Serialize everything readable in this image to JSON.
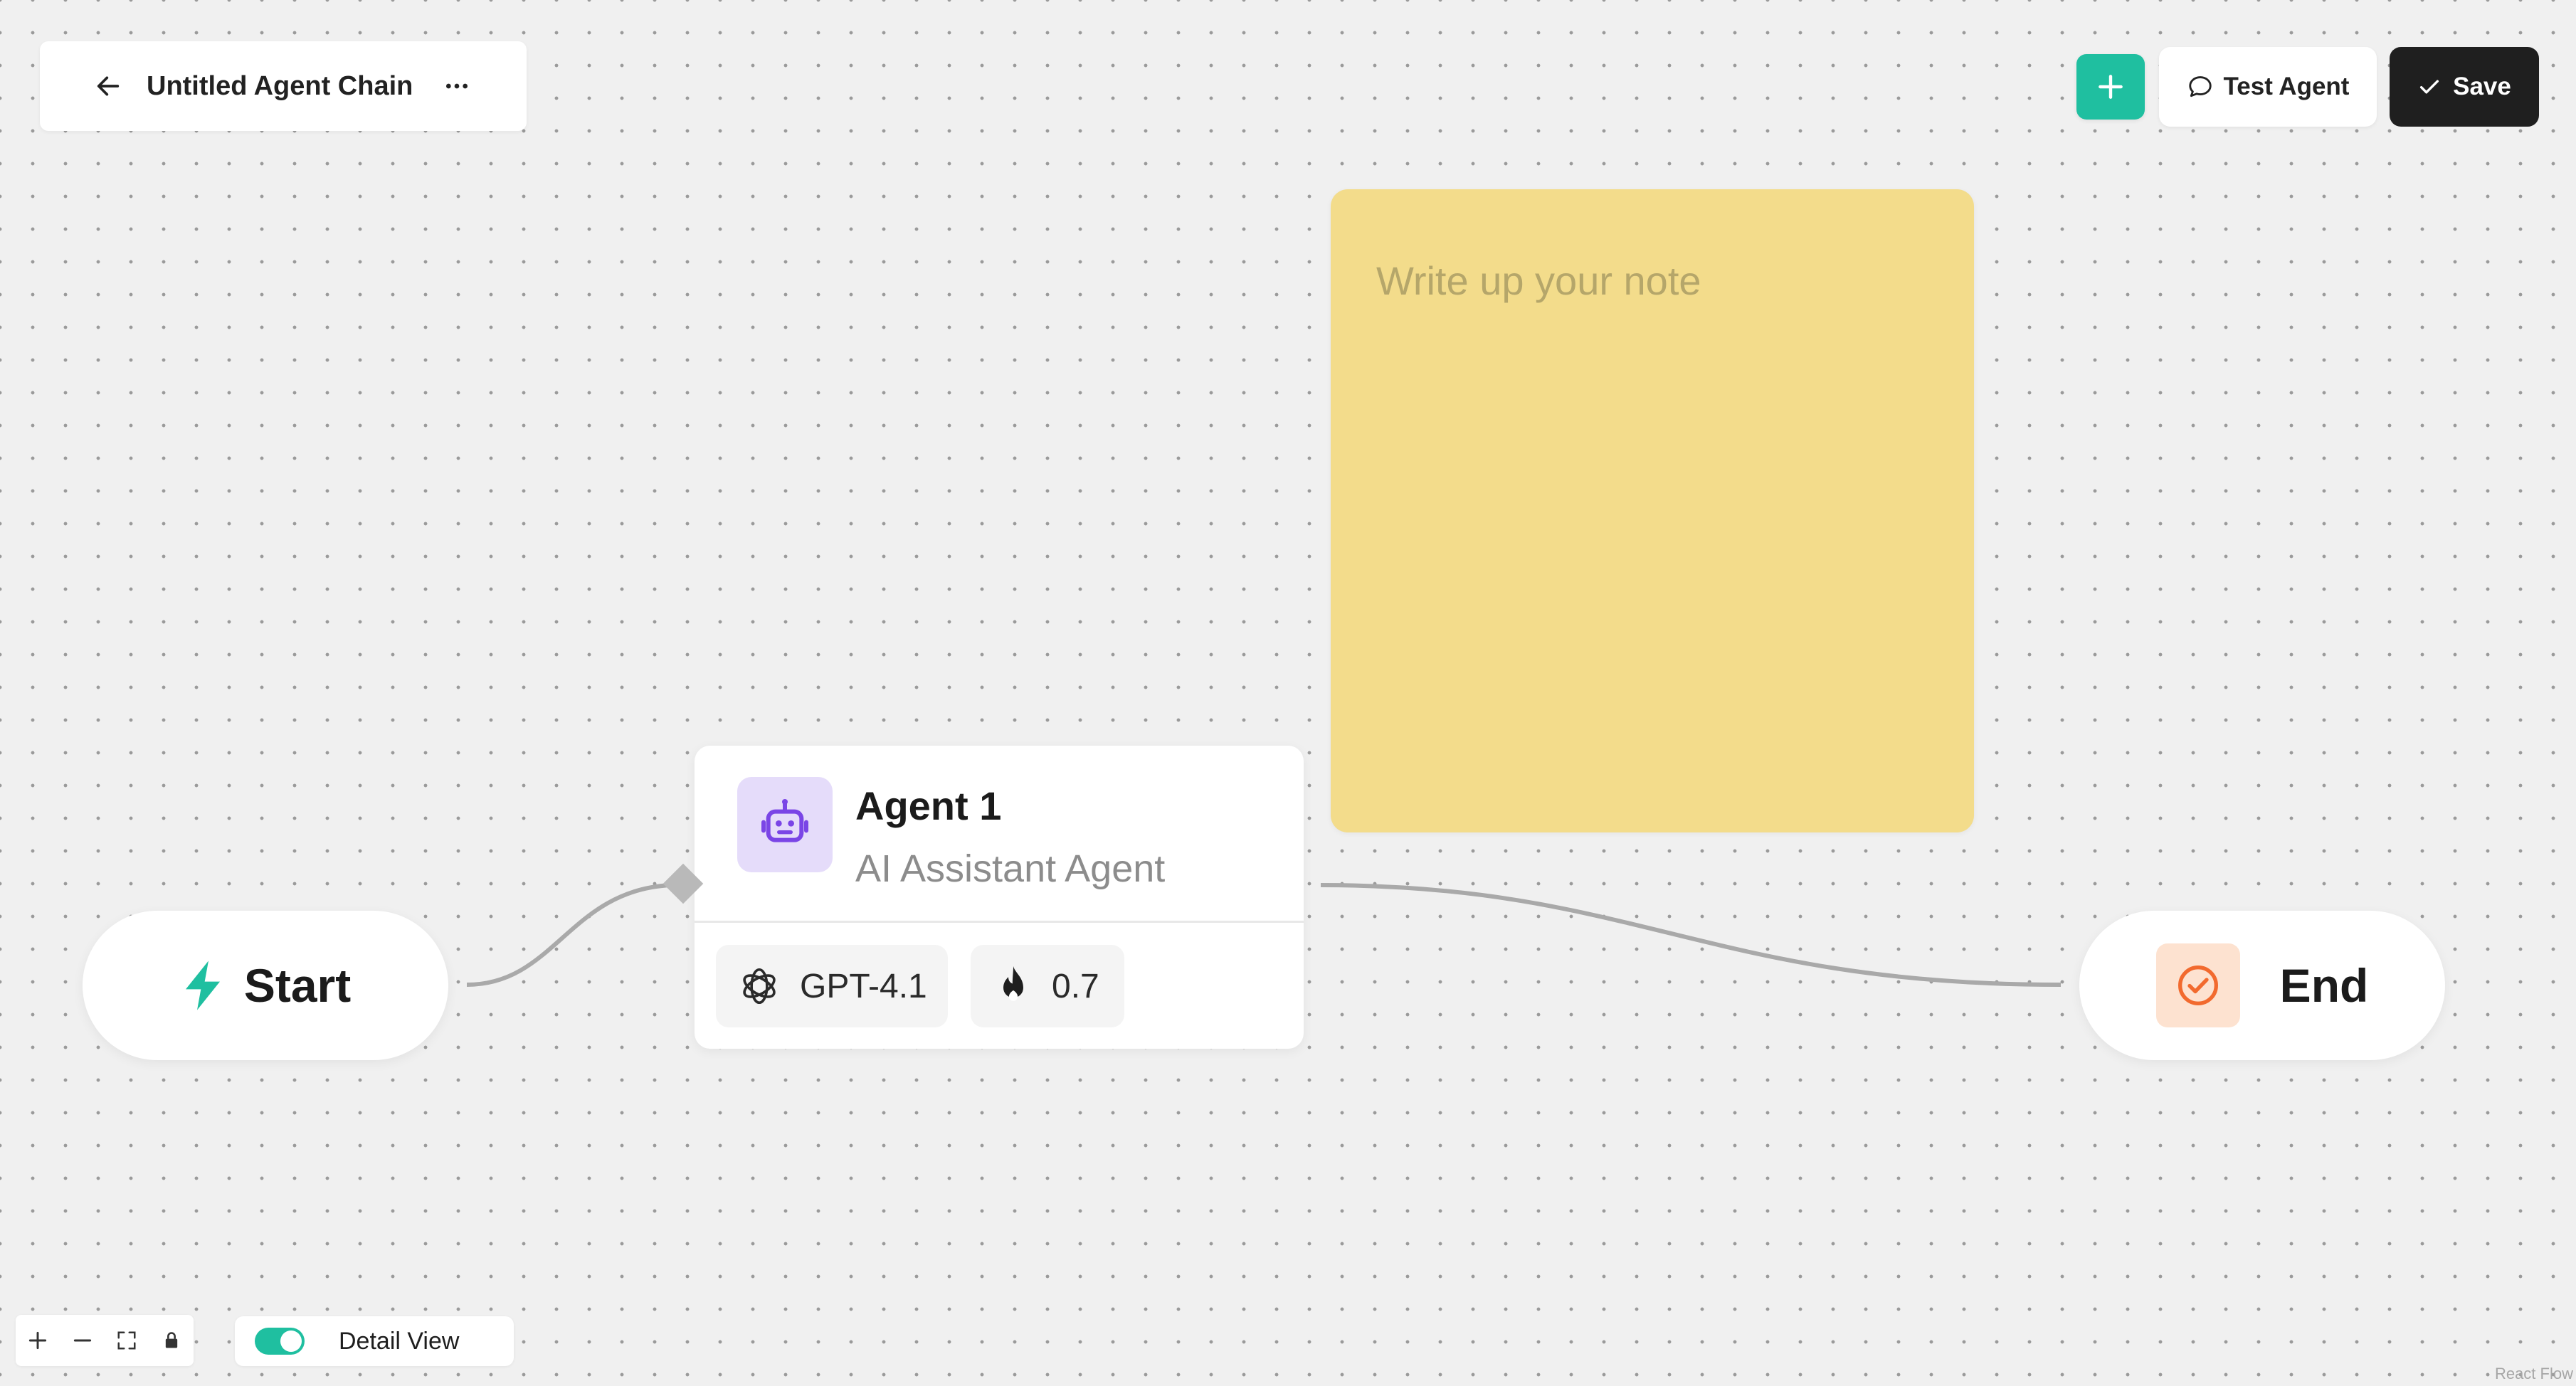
{
  "header": {
    "title": "Untitled Agent Chain",
    "back_icon": "arrow-left-icon",
    "more_icon": "ellipsis-icon"
  },
  "toolbar": {
    "add_icon": "plus-icon",
    "test_label": "Test Agent",
    "test_icon": "chat-bubble-icon",
    "save_label": "Save",
    "save_icon": "check-icon"
  },
  "note": {
    "placeholder": "Write up your note",
    "color": "#f3dc8b"
  },
  "nodes": {
    "start": {
      "label": "Start",
      "icon": "lightning-icon",
      "icon_color": "#1fbfa0"
    },
    "end": {
      "label": "End",
      "icon": "check-circle-icon",
      "icon_color": "#f26a2e"
    },
    "agent": {
      "name": "Agent 1",
      "subtitle": "AI Assistant Agent",
      "icon": "robot-icon",
      "model": "GPT-4.1",
      "model_icon": "openai-icon",
      "temperature": "0.7",
      "temperature_icon": "flame-icon"
    }
  },
  "canvas_controls": {
    "zoom_in_icon": "plus-icon",
    "zoom_out_icon": "minus-icon",
    "fit_view_icon": "fit-view-icon",
    "lock_icon": "lock-icon"
  },
  "detail_view": {
    "label": "Detail View",
    "enabled": true
  },
  "attribution": "React Flow",
  "colors": {
    "accent": "#1fbfa0",
    "dark": "#1f1f1f",
    "canvas": "#f0f0f0"
  }
}
